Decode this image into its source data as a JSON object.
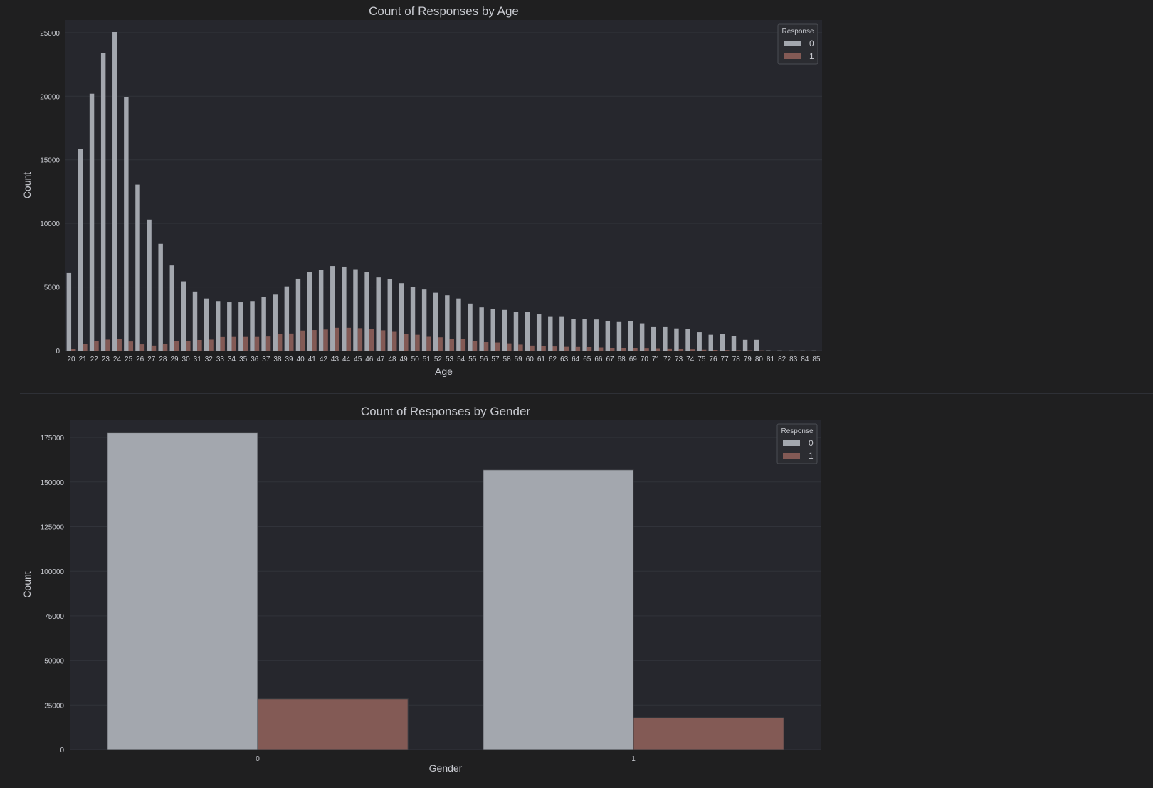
{
  "colors": {
    "page_bg": "#1f1f20",
    "axes_bg": "#26272d",
    "grid": "#31333a",
    "text": "#c8cad0",
    "response_0": "#a3a7ae",
    "response_1": "#835a55",
    "legend_bg": "#2b2c31",
    "legend_border": "#4a4c52"
  },
  "chart_data": [
    {
      "type": "bar",
      "title": "Count of Responses by Age",
      "xlabel": "Age",
      "ylabel": "Count",
      "ylim": [
        0,
        26000
      ],
      "yticks": [
        0,
        5000,
        10000,
        15000,
        20000,
        25000
      ],
      "grid": true,
      "legend": {
        "title": "Response",
        "placement": "top-right",
        "labels": [
          "0",
          "1"
        ]
      },
      "categories": [
        "20",
        "21",
        "22",
        "23",
        "24",
        "25",
        "26",
        "27",
        "28",
        "29",
        "30",
        "31",
        "32",
        "33",
        "34",
        "35",
        "36",
        "37",
        "38",
        "39",
        "40",
        "41",
        "42",
        "43",
        "44",
        "45",
        "46",
        "47",
        "48",
        "49",
        "50",
        "51",
        "52",
        "53",
        "54",
        "55",
        "56",
        "57",
        "58",
        "59",
        "60",
        "61",
        "62",
        "63",
        "64",
        "65",
        "66",
        "67",
        "68",
        "69",
        "70",
        "71",
        "72",
        "73",
        "74",
        "75",
        "76",
        "77",
        "78",
        "79",
        "80",
        "81",
        "82",
        "83",
        "84",
        "85"
      ],
      "series": [
        {
          "name": "0",
          "values": [
            6100,
            15850,
            20200,
            23400,
            25050,
            19950,
            13050,
            10300,
            8400,
            6700,
            5450,
            4650,
            4100,
            3900,
            3800,
            3800,
            3900,
            4250,
            4400,
            5050,
            5650,
            6150,
            6350,
            6650,
            6600,
            6400,
            6150,
            5750,
            5600,
            5300,
            5000,
            4800,
            4550,
            4350,
            4100,
            3700,
            3400,
            3250,
            3200,
            3050,
            3050,
            2850,
            2650,
            2650,
            2500,
            2500,
            2450,
            2350,
            2250,
            2300,
            2150,
            1850,
            1850,
            1750,
            1700,
            1450,
            1250,
            1300,
            1150,
            850,
            850,
            20,
            15,
            10,
            10,
            10
          ]
        },
        {
          "name": "1",
          "values": [
            110,
            540,
            730,
            870,
            910,
            720,
            500,
            400,
            560,
            730,
            780,
            840,
            870,
            1070,
            1080,
            1080,
            1080,
            1110,
            1300,
            1350,
            1580,
            1620,
            1660,
            1800,
            1800,
            1770,
            1700,
            1600,
            1480,
            1300,
            1250,
            1090,
            1050,
            950,
            920,
            750,
            670,
            640,
            580,
            480,
            400,
            360,
            330,
            300,
            290,
            280,
            250,
            220,
            180,
            180,
            160,
            140,
            120,
            110,
            100,
            70,
            55,
            45,
            30,
            25,
            20,
            0,
            0,
            0,
            0,
            0
          ]
        }
      ]
    },
    {
      "type": "bar",
      "title": "Count of Responses by Gender",
      "xlabel": "Gender",
      "ylabel": "Count",
      "ylim": [
        0,
        185000
      ],
      "yticks": [
        0,
        25000,
        50000,
        75000,
        100000,
        125000,
        150000,
        175000
      ],
      "grid": true,
      "legend": {
        "title": "Response",
        "placement": "top-right",
        "labels": [
          "0",
          "1"
        ]
      },
      "categories": [
        "0",
        "1"
      ],
      "series": [
        {
          "name": "0",
          "values": [
            177600,
            156800
          ]
        },
        {
          "name": "1",
          "values": [
            28400,
            18000
          ]
        }
      ]
    }
  ]
}
